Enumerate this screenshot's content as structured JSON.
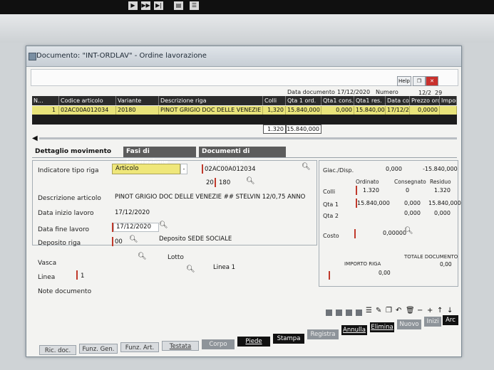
{
  "window": {
    "title": "Documento: \"INT-ORDLAV\" - Ordine lavorazione"
  },
  "header": {
    "data_documento_label": "Data documento",
    "data_documento_value": "17/12/2020",
    "numero_label": "Numero",
    "numero_value": "12/2",
    "numero_suffix": "29",
    "window_btn": "Help"
  },
  "grid": {
    "columns": [
      "N...",
      "Codice articolo",
      "Variante",
      "Descrizione riga",
      "Colli",
      "Qta 1 ord.",
      "Qta1 cons.",
      "Qta1 res.",
      "Data co...",
      "Prezzo ord...",
      "Importo"
    ],
    "row": {
      "n": "1",
      "codice": "02AC00A012034",
      "variante": "20180",
      "descrizione": "PINOT GRIGIO DOC DELLE VENEZIE",
      "colli": "1,320",
      "qta_ord": "15.840,000",
      "qta_cons": "0,000",
      "qta_res": "15.840,000",
      "data_co": "17/12/2020",
      "prezzo": "0,0000",
      "importo": ""
    },
    "totals": {
      "colli": "1.320",
      "qta_ord": "15.840,000"
    }
  },
  "tabs": [
    "Dettaglio movimento",
    "Fasi di lavorazione",
    "Documenti di riferimento"
  ],
  "detail": {
    "indicatore_label": "Indicatore tipo riga",
    "indicatore_value": "Articolo",
    "codice_value": "02AC00A012034",
    "variante_a": "20",
    "variante_b": "180",
    "descrizione_label": "Descrizione articolo",
    "descrizione_value": "PINOT GRIGIO DOC DELLE VENEZIE ## STELVIN 12/0,75 ANNO",
    "data_inizio_label": "Data inizio lavoro",
    "data_inizio_value": "17/12/2020",
    "data_fine_label": "Data fine lavoro",
    "data_fine_value": "17/12/2020",
    "deposito_label": "Deposito riga",
    "deposito_code": "00",
    "deposito_desc": "Deposito SEDE SOCIALE",
    "vasca_label": "Vasca",
    "lotto_label": "Lotto",
    "linea_label": "Linea",
    "linea_value": "1",
    "linea_desc": "Linea 1",
    "note_label": "Note documento"
  },
  "right_panel": {
    "giac_label": "Giac./Disp.",
    "giac_value": "0,000",
    "giac_value2": "-15.840,000",
    "ordinato_label": "Ordinato",
    "consegnato_label": "Consegnato",
    "residuo_label": "Residuo",
    "colli_label": "Colli",
    "colli_ord": "1.320",
    "colli_cons": "0",
    "colli_res": "1.320",
    "qta1_label": "Qta 1",
    "qta1_ord": "15.840,000",
    "qta1_cons": "0,000",
    "qta1_res": "15.840,000",
    "qta2_label": "Qta 2",
    "qta2_cons": "0,000",
    "qta2_res": "0,000",
    "costo_label": "Costo",
    "costo_value": "0,00000",
    "importo_label": "IMPORTO RIGA",
    "importo_value": "0,00",
    "totale_label": "TOTALE DOCUMENTO",
    "totale_value": "0,00"
  },
  "bottom_buttons": [
    "Ric. doc.",
    "Funz. Gen.",
    "Funz. Art.",
    "Testata",
    "Corpo",
    "Piede",
    "Stampa",
    "Registra",
    "Annulla",
    "Elimina",
    "Nuovo",
    "Inizi",
    "Arc"
  ]
}
